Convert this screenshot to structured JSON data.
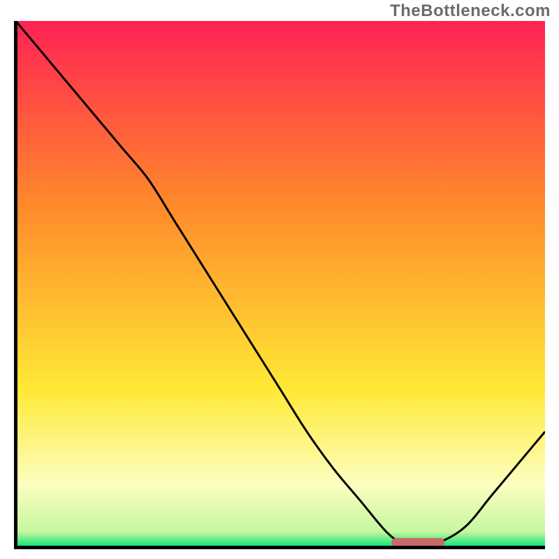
{
  "attribution": "TheBottleneck.com",
  "colors": {
    "gradient_top": "#ff2254",
    "gradient_mid1": "#ff8a2b",
    "gradient_mid2": "#ffe935",
    "gradient_band": "#fdfec0",
    "gradient_bottom": "#00e472",
    "curve": "#000000",
    "axis": "#000000",
    "marker": "#c96a6a"
  },
  "chart_data": {
    "type": "line",
    "title": "",
    "xlabel": "",
    "ylabel": "",
    "xlim": [
      0,
      100
    ],
    "ylim": [
      0,
      100
    ],
    "series": [
      {
        "name": "bottleneck-curve",
        "x": [
          0,
          5,
          10,
          15,
          20,
          25,
          30,
          35,
          40,
          45,
          50,
          55,
          60,
          65,
          70,
          73,
          77,
          80,
          85,
          90,
          95,
          100
        ],
        "y": [
          100,
          94,
          88,
          82,
          76,
          70,
          62,
          54,
          46,
          38,
          30,
          22,
          15,
          9,
          3,
          1,
          1,
          1,
          4,
          10,
          16,
          22
        ]
      }
    ],
    "marker": {
      "name": "optimal-range",
      "x_start": 71,
      "x_end": 81,
      "y": 1
    },
    "gradient_stops": [
      {
        "offset": 0.0,
        "color": "#ff2254"
      },
      {
        "offset": 0.35,
        "color": "#ff8a2b"
      },
      {
        "offset": 0.7,
        "color": "#ffe935"
      },
      {
        "offset": 0.88,
        "color": "#fdfec0"
      },
      {
        "offset": 0.97,
        "color": "#c7f7a0"
      },
      {
        "offset": 1.0,
        "color": "#00e472"
      }
    ]
  }
}
